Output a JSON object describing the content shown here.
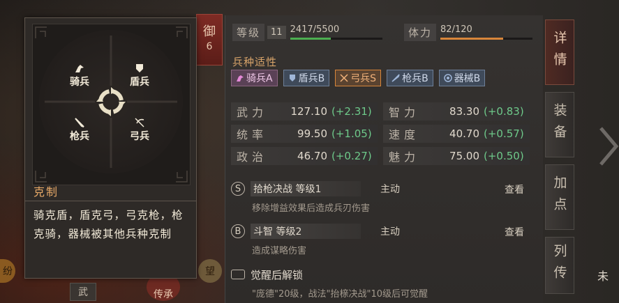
{
  "yu_tab": {
    "char": "御",
    "num": "6"
  },
  "stats": {
    "level_label": "等级",
    "level_value": "11",
    "exp_text": "2417/5500",
    "exp_fraction": 0.44,
    "stamina_label": "体力",
    "stamina_text": "82/120",
    "stamina_fraction": 0.68
  },
  "traits": {
    "heading": "兵种适性",
    "items": [
      {
        "label": "骑兵A",
        "icon": "horse-icon"
      },
      {
        "label": "盾兵B",
        "icon": "shield-icon"
      },
      {
        "label": "弓兵S",
        "icon": "bow-icon"
      },
      {
        "label": "枪兵B",
        "icon": "spear-icon"
      },
      {
        "label": "器械B",
        "icon": "gear-icon"
      }
    ]
  },
  "attributes": [
    {
      "name": "武力",
      "value": "127.10",
      "bonus": "(+2.31)"
    },
    {
      "name": "智力",
      "value": "83.30",
      "bonus": "(+0.83)"
    },
    {
      "name": "统率",
      "value": "99.50",
      "bonus": "(+1.05)"
    },
    {
      "name": "速度",
      "value": "40.70",
      "bonus": "(+0.57)"
    },
    {
      "name": "政治",
      "value": "46.70",
      "bonus": "(+0.27)"
    },
    {
      "name": "魅力",
      "value": "75.00",
      "bonus": "(+0.50)"
    }
  ],
  "skills": [
    {
      "badge": "S",
      "title": "拾枪决战 等级1",
      "type": "主动",
      "view": "查看",
      "desc": "移除增益效果后造成兵刃伤害"
    },
    {
      "badge": "B",
      "title": "斗智 等级2",
      "type": "主动",
      "view": "查看",
      "desc": "造成谋略伤害"
    }
  ],
  "awaken": {
    "title": "觉醒后解锁",
    "desc": "\"庞德\"20级，战法\"抬榇决战\"10级后可觉醒"
  },
  "right_tabs": [
    "详情",
    "装备",
    "加点",
    "列传"
  ],
  "right_edge_text": "未",
  "tooltip": {
    "units": {
      "cavalry": "骑兵",
      "shield": "盾兵",
      "spear": "枪兵",
      "archer": "弓兵"
    },
    "title": "克制",
    "body": "骑克盾，盾克弓，弓克枪，枪克骑，器械被其他兵种克制"
  },
  "bottom": {
    "wu": "武",
    "chuan": "传",
    "cheng": "承",
    "wang": "望",
    "fen": "纷"
  },
  "colors": {
    "accent_orange": "#e6a867",
    "bonus_green": "#6ec98a",
    "exp_bar": "#4caf50",
    "stamina_bar": "#d8863a",
    "active_tab": "#4f2a23"
  }
}
